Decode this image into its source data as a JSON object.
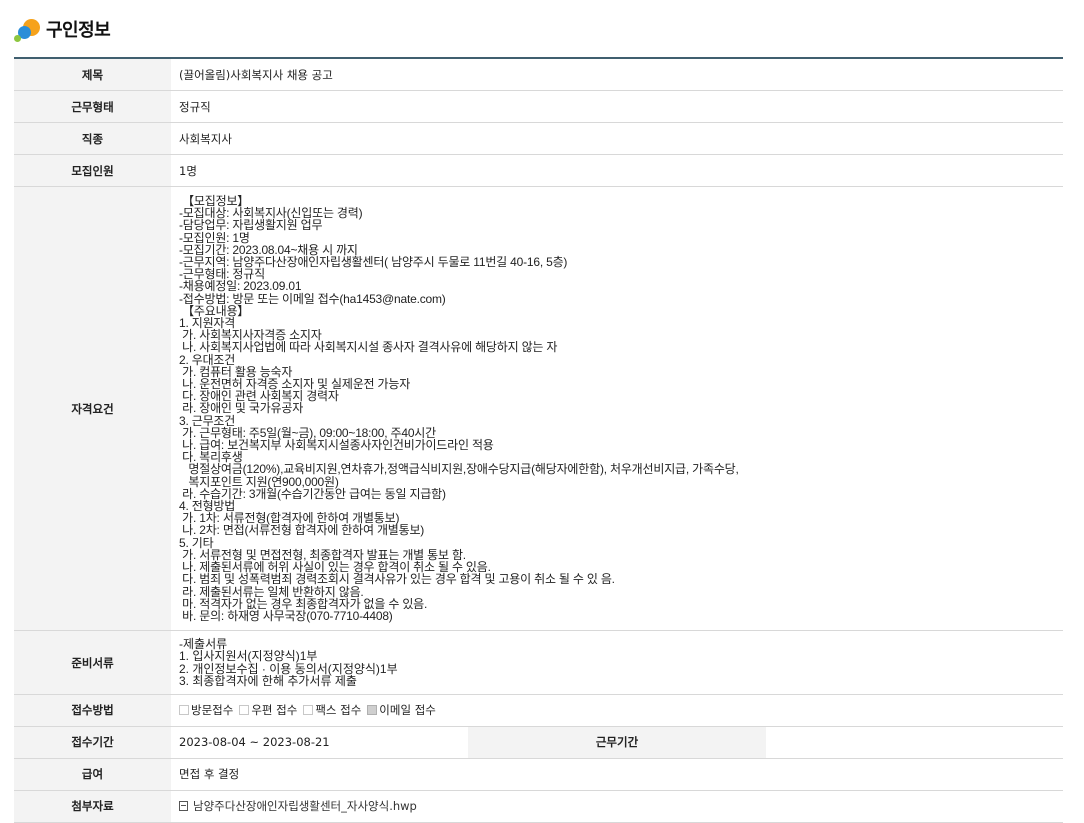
{
  "header": {
    "title": "구인정보"
  },
  "rows": {
    "title": {
      "label": "제목",
      "value": "(끌어올림)사회복지사 채용 공고"
    },
    "work_type": {
      "label": "근무형태",
      "value": "정규직"
    },
    "job": {
      "label": "직종",
      "value": "사회복지사"
    },
    "headcount": {
      "label": "모집인원",
      "value": "1명"
    },
    "requirements": {
      "label": "자격요건",
      "value": " 【모집정보】\n-모집대상: 사회복지사(신입또는 경력)\n-담당업무: 자립생활지원 업무\n-모집인원: 1명\n-모집기간: 2023.08.04~채용 시 까지\n-근무지역: 남양주다산장애인자립생활센터( 남양주시 두물로 11번길 40-16, 5층)\n-근무형태: 정규직\n-채용예정일: 2023.09.01\n-접수방법: 방문 또는 이메일 접수(ha1453@nate.com)\n 【주요내용】\n1. 지원자격\n 가. 사회복지사자격증 소지자\n 나. 사회복지사업법에 따라 사회복지시설 종사자 결격사유에 해당하지 않는 자\n2. 우대조건\n 가. 컴퓨터 활용 능숙자\n 나. 운전면허 자격증 소지자 및 실제운전 가능자\n 다. 장애인 관련 사회복지 경력자\n 라. 장애인 및 국가유공자\n3. 근무조건\n 가. 근무형태: 주5일(월~금), 09:00~18:00, 주40시간\n 나. 급여: 보건복지부 사회복지시설종사자인건비가이드라인 적용\n 다. 복리후생\n   명절상여금(120%),교육비지원,연차휴가,정액급식비지원,장애수당지급(해당자에한함), 처우개선비지급, 가족수당,\n   복지포인트 지원(연900,000원)\n 라. 수습기간: 3개월(수습기간동안 급여는 동일 지급함)\n4. 전형방법\n 가. 1차: 서류전형(합격자에 한하여 개별통보)\n 나. 2차: 면접(서류전형 합격자에 한하여 개별통보)\n5. 기타\n 가. 서류전형 및 면접전형, 최종합격자 발표는 개별 통보 함.\n 나. 제출된서류에 허위 사실이 있는 경우 합격이 취소 될 수 있음.\n 다. 범죄 및 성폭력범죄 경력조회시 결격사유가 있는 경우 합격 및 고용이 취소 될 수 있 음.\n 라. 제출된서류는 일체 반환하지 않음.\n 마. 적격자가 없는 경우 최종합격자가 없을 수 있음.\n 바. 문의: 하재영 사무국장(070-7710-4408)"
    },
    "documents": {
      "label": "준비서류",
      "value": "-제출서류\n1. 입사지원서(지정양식)1부\n2. 개인정보수집 · 이용 동의서(지정양식)1부\n3. 최종합격자에 한해 추가서류 제출"
    },
    "apply_method": {
      "label": "접수방법",
      "options": [
        {
          "label": "방문접수",
          "checked": false
        },
        {
          "label": "우편 접수",
          "checked": false
        },
        {
          "label": "팩스 접수",
          "checked": false
        },
        {
          "label": "이메일 접수",
          "checked": true
        }
      ]
    },
    "apply_period": {
      "label": "접수기간",
      "value": "2023-08-04 ~ 2023-08-21",
      "work_period_label": "근무기간",
      "work_period_value": ""
    },
    "salary": {
      "label": "급여",
      "value": "면접 후 결정"
    },
    "attachment": {
      "label": "첨부자료",
      "file_name": "남양주다산장애인자립생활센터_자사양식.hwp"
    }
  },
  "colors": {
    "table_top_border": "#405f6f",
    "header_cell_bg": "#f3f3f3"
  }
}
